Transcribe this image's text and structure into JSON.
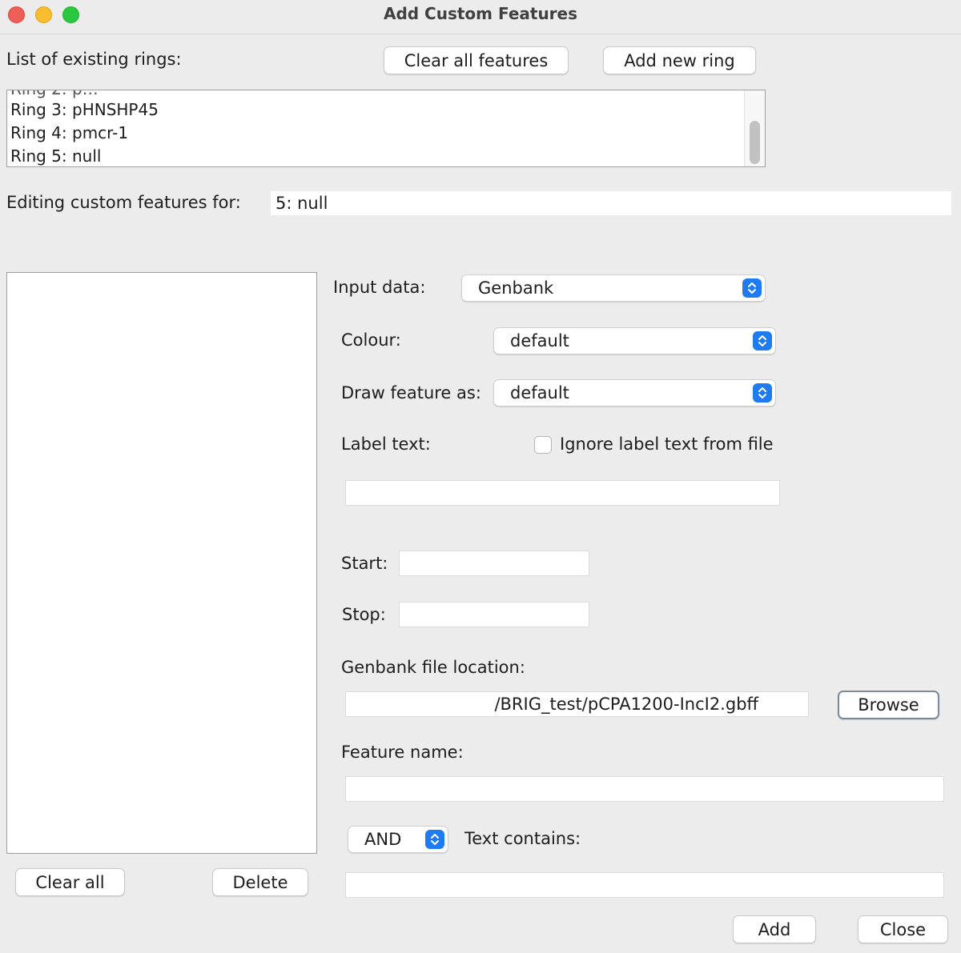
{
  "window": {
    "title": "Add Custom Features",
    "controls": {
      "close_color": "#ee5f57",
      "minimize_color": "#f7bd2f",
      "zoom_color": "#29c840"
    }
  },
  "rings": {
    "label": "List of existing rings:",
    "clear_all_features_label": "Clear all features",
    "add_new_ring_label": "Add new ring",
    "items": [
      "Ring 3: pHNSHP45",
      "Ring 4: pmcr-1",
      "Ring 5: null"
    ]
  },
  "editing": {
    "label": "Editing custom features for:",
    "value": "5: null"
  },
  "feature_list": {
    "clear_all_label": "Clear all",
    "delete_label": "Delete"
  },
  "form": {
    "input_data": {
      "label": "Input data:",
      "value": "Genbank"
    },
    "colour": {
      "label": "Colour:",
      "value": "default"
    },
    "draw_feature_as": {
      "label": "Draw feature as:",
      "value": "default"
    },
    "label_text": {
      "label": "Label text:",
      "ignore_label": "Ignore label text from file",
      "ignore_checked": false,
      "value": ""
    },
    "start": {
      "label": "Start:",
      "value": ""
    },
    "stop": {
      "label": "Stop:",
      "value": ""
    },
    "genbank_file": {
      "label": "Genbank file location:",
      "value": "/BRIG_test/pCPA1200-IncI2.gbff",
      "browse_label": "Browse"
    },
    "feature_name": {
      "label": "Feature name:",
      "value": ""
    },
    "operator": {
      "value": "AND"
    },
    "text_contains": {
      "label": "Text contains:",
      "value": ""
    }
  },
  "footer": {
    "add_label": "Add",
    "close_label": "Close"
  },
  "accent_color": "#1f7bf2"
}
